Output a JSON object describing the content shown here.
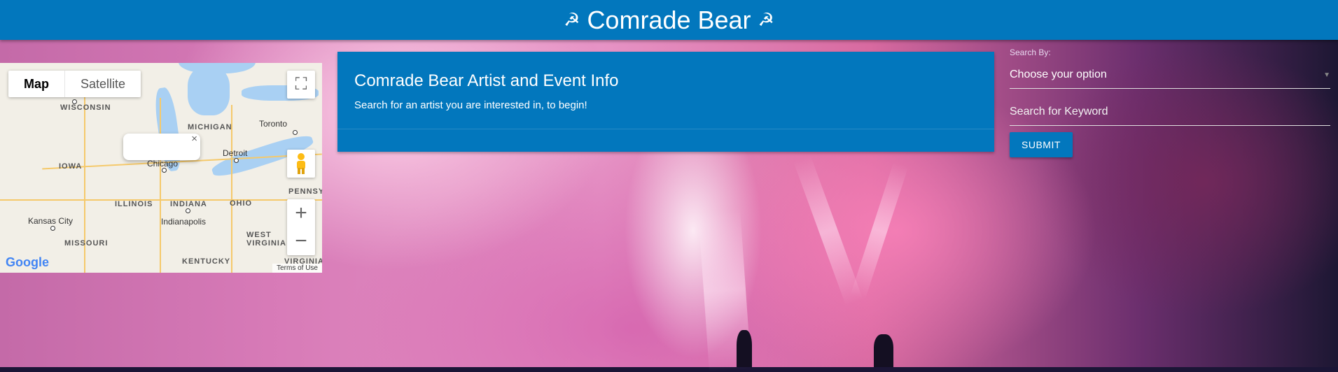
{
  "header": {
    "title": "Comrade Bear",
    "left_icon": "☭",
    "right_icon": "☭"
  },
  "map": {
    "map_tab": "Map",
    "satellite_tab": "Satellite",
    "fullscreen_icon": "⛶",
    "zoom_in": "+",
    "zoom_out": "−",
    "close_glyph": "×",
    "logo": "Google",
    "terms": "Terms of Use",
    "places": {
      "wisconsin": "WISCONSIN",
      "michigan": "MICHIGAN",
      "toronto": "Toronto",
      "iowa": "IOWA",
      "chicago": "Chicago",
      "detroit": "Detroit",
      "pennsy": "PENNSY",
      "illinois": "ILLINOIS",
      "indiana": "INDIANA",
      "ohio": "OHIO",
      "kansas_city": "Kansas City",
      "indianapolis": "Indianapolis",
      "missouri": "MISSOURI",
      "west_virginia": "WEST VIRGINIA",
      "kentucky": "KENTUCKY",
      "virginia": "VIRGINIA"
    }
  },
  "info": {
    "title": "Comrade Bear Artist and Event Info",
    "subtitle": "Search for an artist you are interested in, to begin!"
  },
  "search": {
    "by_label": "Search By:",
    "select_value": "Choose your option",
    "keyword_placeholder": "Search for Keyword",
    "submit_label": "SUBMIT"
  },
  "colors": {
    "primary": "#0277bd"
  }
}
